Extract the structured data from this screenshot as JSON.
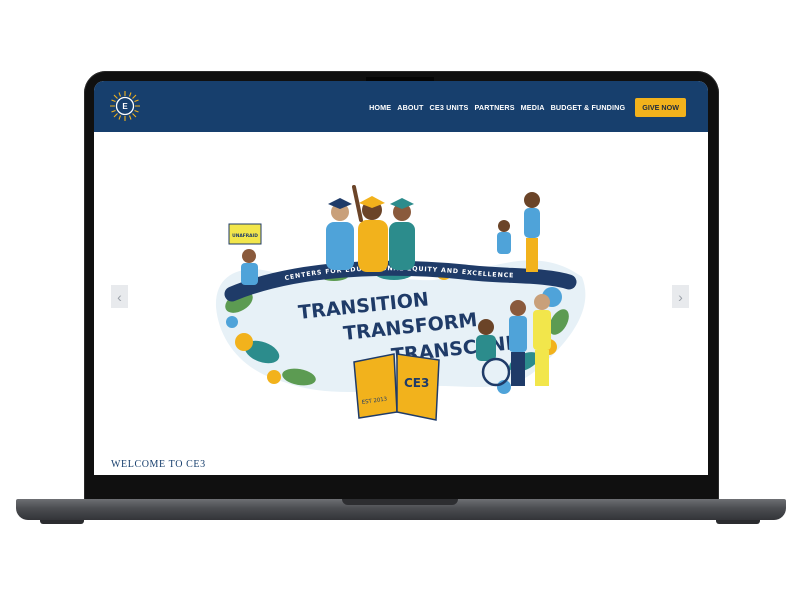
{
  "nav": {
    "items": [
      {
        "label": "HOME"
      },
      {
        "label": "ABOUT"
      },
      {
        "label": "CE3 UNITS"
      },
      {
        "label": "PARTNERS"
      },
      {
        "label": "MEDIA"
      },
      {
        "label": "BUDGET & FUNDING"
      }
    ],
    "cta_label": "GIVE NOW",
    "logo_icon": "ce3-sunburst-logo"
  },
  "hero": {
    "banner_arc_text": "CENTERS FOR EDUCATIONAL EQUITY AND EXCELLENCE",
    "banner_lines": [
      "TRANSITION",
      "TRANSFORM",
      "TRANSCEND"
    ],
    "book_label": "CE3",
    "est_label": "EST 2013",
    "sign_label": "UNAFRAID",
    "prev_icon": "chevron-left-icon",
    "next_icon": "chevron-right-icon"
  },
  "welcome": {
    "title": "WELCOME TO CE3"
  },
  "colors": {
    "nav_bg": "#173f6d",
    "accent": "#f2b21c",
    "navy": "#1f3b68",
    "teal": "#2c8c8c",
    "leaf_green": "#5c9b52"
  }
}
